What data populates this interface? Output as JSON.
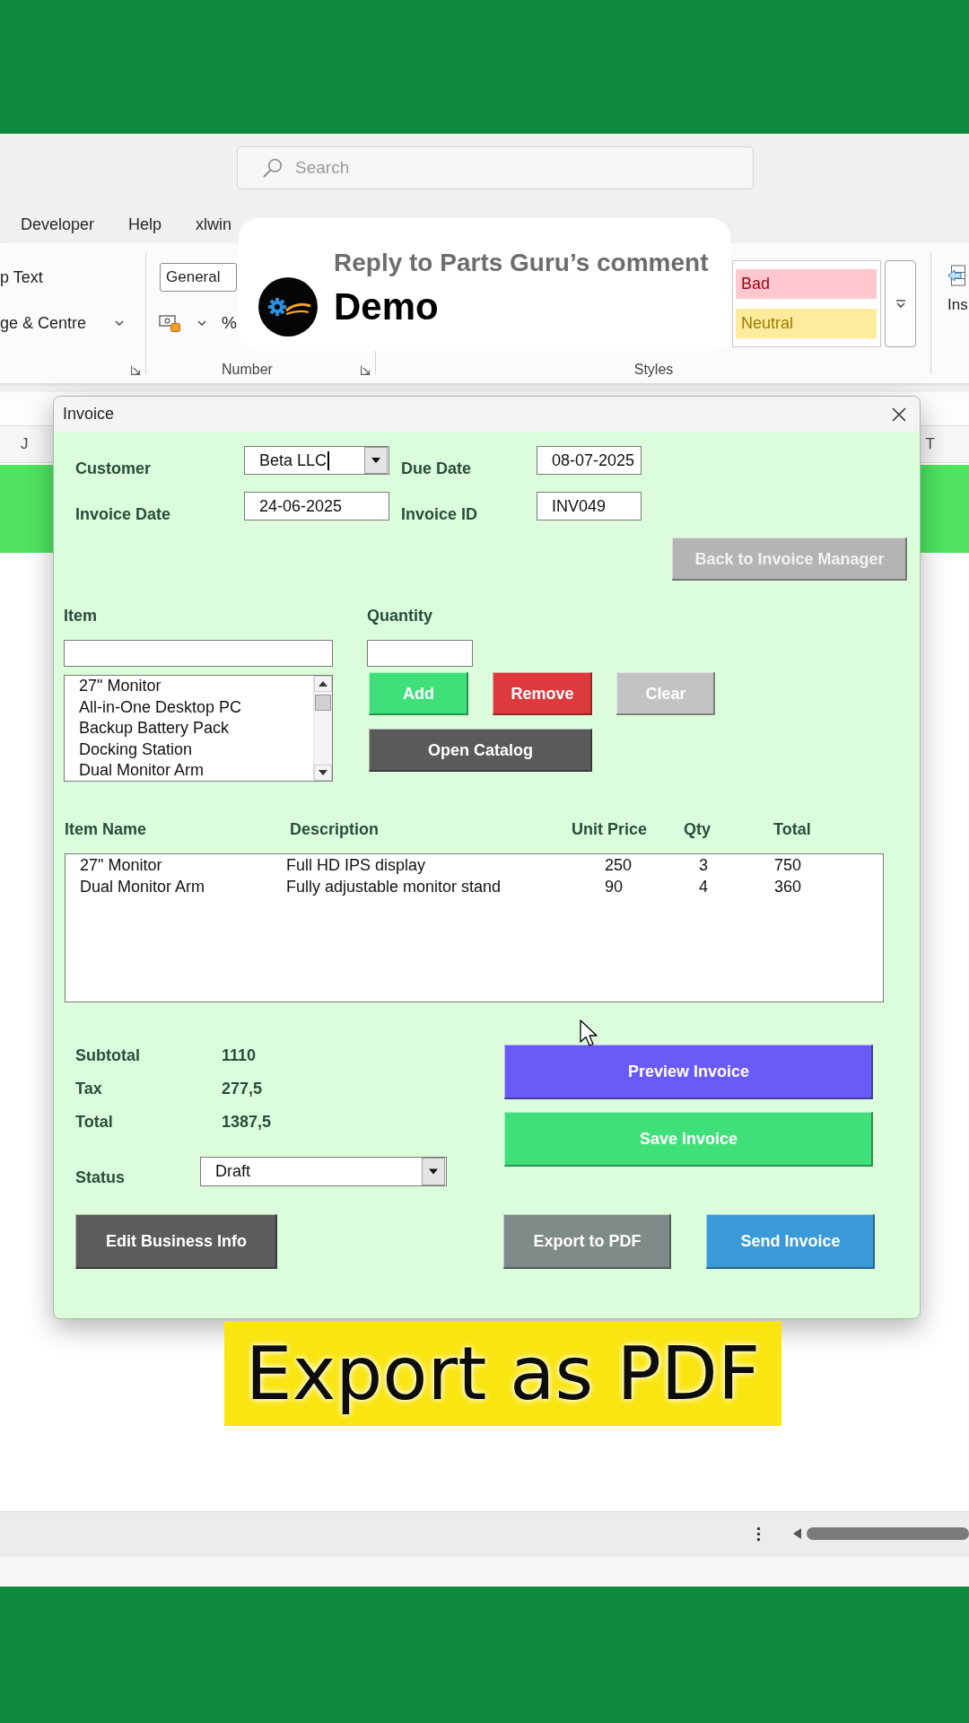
{
  "excel": {
    "search": {
      "placeholder": "Search"
    },
    "ribbon_tabs": [
      "Developer",
      "Help",
      "xlwin"
    ],
    "ribbon": {
      "alignment": {
        "commands": [
          {
            "label": "p Text",
            "kind": "button"
          },
          {
            "label": "ge & Centre",
            "kind": "dropdown"
          }
        ]
      },
      "number": {
        "format": "General",
        "percent": "%",
        "label": "Number"
      },
      "styles": {
        "cells": [
          {
            "label": "Bad",
            "color": "#ffc7ce"
          },
          {
            "label": "Neutral",
            "color": "#ffeb9c"
          }
        ],
        "label": "Styles"
      },
      "insert": {
        "label": "Ins"
      }
    },
    "column_headers": [
      "J",
      "T"
    ]
  },
  "reply": {
    "heading": "Reply to Parts Guru’s comment",
    "text": "Demo"
  },
  "dialog": {
    "title": "Invoice",
    "fields": [
      {
        "label": "Customer",
        "value": "Beta LLC",
        "kind": "combo",
        "focused": true
      },
      {
        "label": "Due Date",
        "value": "08-07-2025",
        "kind": "text",
        "focused": false
      },
      {
        "label": "Invoice Date",
        "value": "24-06-2025",
        "kind": "text",
        "focused": false
      },
      {
        "label": "Invoice ID",
        "value": "INV049",
        "kind": "text",
        "focused": false
      }
    ],
    "back_button": {
      "label": "Back to Invoice Manager"
    },
    "item": {
      "label": "Item",
      "list": [
        {
          "label": "27\" Monitor",
          "selected": false
        },
        {
          "label": "All-in-One Desktop PC",
          "selected": false
        },
        {
          "label": "Backup Battery Pack",
          "selected": false
        },
        {
          "label": "Docking Station",
          "selected": false
        },
        {
          "label": "Dual Monitor Arm",
          "selected": false
        }
      ]
    },
    "quantity": {
      "label": "Quantity"
    },
    "item_buttons": [
      {
        "label": "Add",
        "color": "#3fe07a"
      },
      {
        "label": "Remove",
        "color": "#dd3a3e"
      },
      {
        "label": "Clear",
        "color": "#c3c3c3"
      },
      {
        "label": "Open Catalog",
        "color": "#5a5a5a"
      }
    ],
    "table": {
      "columns": [
        "Item Name",
        "Description",
        "Unit Price",
        "Qty",
        "Total"
      ],
      "rows": [
        {
          "cells": [
            "27\" Monitor",
            "Full HD IPS display",
            "250",
            "3",
            "750"
          ],
          "selected": false
        },
        {
          "cells": [
            "Dual Monitor Arm",
            "Fully adjustable monitor stand",
            "90",
            "4",
            "360"
          ],
          "selected": false
        }
      ]
    },
    "totals": [
      {
        "label": "Subtotal",
        "value": "1110"
      },
      {
        "label": "Tax",
        "value": "277,5"
      },
      {
        "label": "Total",
        "value": "1387,5"
      }
    ],
    "status": {
      "label": "Status",
      "value": "Draft"
    },
    "action_buttons": [
      {
        "label": "Preview Invoice",
        "color": "#6a5af7"
      },
      {
        "label": "Save Invoice",
        "color": "#3fe07a"
      }
    ],
    "footer_buttons": [
      {
        "label": "Edit Business Info",
        "color": "#5c5c5c"
      },
      {
        "label": "Export to PDF",
        "color": "#7f8b89"
      },
      {
        "label": "Send Invoice",
        "color": "#3a9ad8"
      }
    ]
  },
  "caption": "Export as PDF"
}
